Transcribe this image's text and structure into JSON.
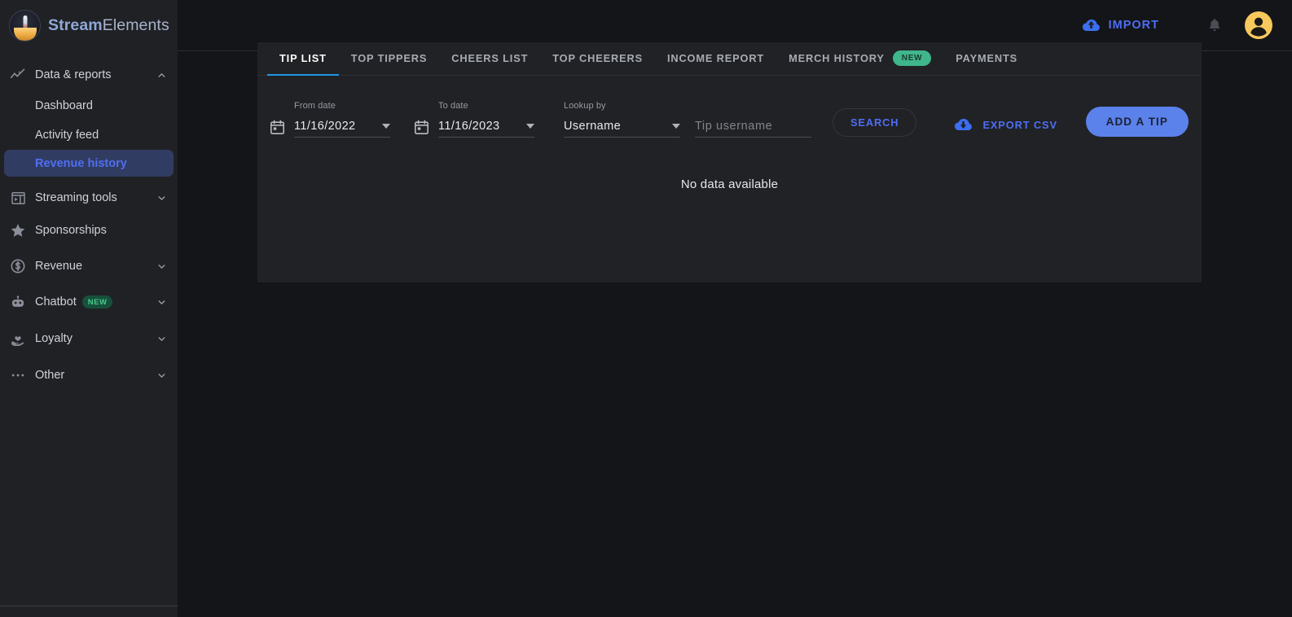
{
  "brand": {
    "name_bold": "Stream",
    "name_light": "Elements",
    "logo_icon": "streamelements-logo-icon"
  },
  "sidebar": {
    "groups": [
      {
        "label": "Data & reports",
        "icon": "analytics-line-icon",
        "chevron": "chevron-up-icon",
        "expanded": true,
        "items": [
          {
            "label": "Dashboard",
            "active": false
          },
          {
            "label": "Activity feed",
            "active": false
          },
          {
            "label": "Revenue history",
            "active": true
          }
        ]
      },
      {
        "label": "Streaming tools",
        "icon": "video-layout-icon",
        "chevron": "chevron-down-icon",
        "expanded": false,
        "items": []
      },
      {
        "label": "Sponsorships",
        "icon": "star-icon",
        "chevron": "",
        "expanded": false,
        "items": []
      },
      {
        "label": "Revenue",
        "icon": "dollar-circle-icon",
        "chevron": "chevron-down-icon",
        "expanded": false,
        "items": []
      },
      {
        "label": "Chatbot",
        "icon": "robot-icon",
        "chevron": "chevron-down-icon",
        "badge": "NEW",
        "expanded": false,
        "items": []
      },
      {
        "label": "Loyalty",
        "icon": "hand-heart-icon",
        "chevron": "chevron-down-icon",
        "expanded": false,
        "items": []
      },
      {
        "label": "Other",
        "icon": "ellipsis-icon",
        "chevron": "chevron-down-icon",
        "expanded": false,
        "items": []
      }
    ]
  },
  "topbar": {
    "import_label": "IMPORT",
    "import_icon": "cloud-upload-icon",
    "bell_icon": "bell-icon",
    "avatar_icon": "user-avatar-icon"
  },
  "panel": {
    "tabs": [
      {
        "label": "TIP LIST",
        "active": true
      },
      {
        "label": "TOP TIPPERS",
        "active": false
      },
      {
        "label": "CHEERS LIST",
        "active": false
      },
      {
        "label": "TOP CHEERERS",
        "active": false
      },
      {
        "label": "INCOME REPORT",
        "active": false
      },
      {
        "label": "MERCH HISTORY",
        "active": false,
        "badge": "NEW"
      },
      {
        "label": "PAYMENTS",
        "active": false
      }
    ],
    "filters": {
      "from_date": {
        "label": "From date",
        "value": "11/16/2022",
        "icon": "calendar-icon",
        "caret": "caret-down-icon"
      },
      "to_date": {
        "label": "To date",
        "value": "11/16/2023",
        "icon": "calendar-icon",
        "caret": "caret-down-icon"
      },
      "lookup_by": {
        "label": "Lookup by",
        "value": "Username",
        "caret": "caret-down-icon"
      },
      "tip_username": {
        "placeholder": "Tip username",
        "value": ""
      },
      "search_label": "SEARCH",
      "export_label": "EXPORT CSV",
      "export_icon": "cloud-download-icon",
      "add_tip_label": "ADD A TIP"
    },
    "empty_message": "No data available"
  },
  "colors": {
    "page_bg": "#141518",
    "sidebar_bg": "#202125",
    "panel_bg": "#212225",
    "accent_blue": "#4d6ef5",
    "tab_underline": "#2196e3",
    "active_nav_bg": "#313c63",
    "active_nav_text": "#4f6ff2",
    "badge_green": "#3fb68b",
    "avatar_yellow": "#f7c85c"
  }
}
